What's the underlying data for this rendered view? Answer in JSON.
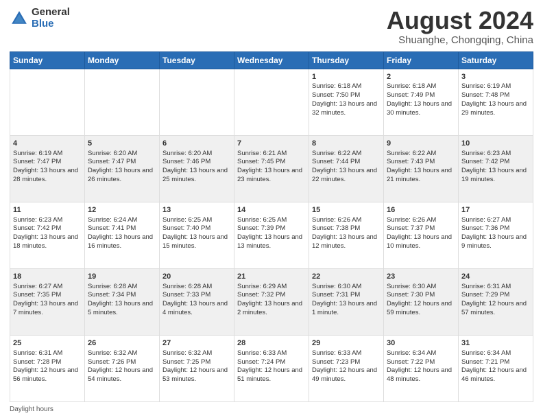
{
  "logo": {
    "general": "General",
    "blue": "Blue"
  },
  "header": {
    "month": "August 2024",
    "location": "Shuanghe, Chongqing, China"
  },
  "days": [
    "Sunday",
    "Monday",
    "Tuesday",
    "Wednesday",
    "Thursday",
    "Friday",
    "Saturday"
  ],
  "weeks": [
    [
      {
        "num": "",
        "data": ""
      },
      {
        "num": "",
        "data": ""
      },
      {
        "num": "",
        "data": ""
      },
      {
        "num": "",
        "data": ""
      },
      {
        "num": "1",
        "data": "Sunrise: 6:18 AM\nSunset: 7:50 PM\nDaylight: 13 hours and 32 minutes."
      },
      {
        "num": "2",
        "data": "Sunrise: 6:18 AM\nSunset: 7:49 PM\nDaylight: 13 hours and 30 minutes."
      },
      {
        "num": "3",
        "data": "Sunrise: 6:19 AM\nSunset: 7:48 PM\nDaylight: 13 hours and 29 minutes."
      }
    ],
    [
      {
        "num": "4",
        "data": "Sunrise: 6:19 AM\nSunset: 7:47 PM\nDaylight: 13 hours and 28 minutes."
      },
      {
        "num": "5",
        "data": "Sunrise: 6:20 AM\nSunset: 7:47 PM\nDaylight: 13 hours and 26 minutes."
      },
      {
        "num": "6",
        "data": "Sunrise: 6:20 AM\nSunset: 7:46 PM\nDaylight: 13 hours and 25 minutes."
      },
      {
        "num": "7",
        "data": "Sunrise: 6:21 AM\nSunset: 7:45 PM\nDaylight: 13 hours and 23 minutes."
      },
      {
        "num": "8",
        "data": "Sunrise: 6:22 AM\nSunset: 7:44 PM\nDaylight: 13 hours and 22 minutes."
      },
      {
        "num": "9",
        "data": "Sunrise: 6:22 AM\nSunset: 7:43 PM\nDaylight: 13 hours and 21 minutes."
      },
      {
        "num": "10",
        "data": "Sunrise: 6:23 AM\nSunset: 7:42 PM\nDaylight: 13 hours and 19 minutes."
      }
    ],
    [
      {
        "num": "11",
        "data": "Sunrise: 6:23 AM\nSunset: 7:42 PM\nDaylight: 13 hours and 18 minutes."
      },
      {
        "num": "12",
        "data": "Sunrise: 6:24 AM\nSunset: 7:41 PM\nDaylight: 13 hours and 16 minutes."
      },
      {
        "num": "13",
        "data": "Sunrise: 6:25 AM\nSunset: 7:40 PM\nDaylight: 13 hours and 15 minutes."
      },
      {
        "num": "14",
        "data": "Sunrise: 6:25 AM\nSunset: 7:39 PM\nDaylight: 13 hours and 13 minutes."
      },
      {
        "num": "15",
        "data": "Sunrise: 6:26 AM\nSunset: 7:38 PM\nDaylight: 13 hours and 12 minutes."
      },
      {
        "num": "16",
        "data": "Sunrise: 6:26 AM\nSunset: 7:37 PM\nDaylight: 13 hours and 10 minutes."
      },
      {
        "num": "17",
        "data": "Sunrise: 6:27 AM\nSunset: 7:36 PM\nDaylight: 13 hours and 9 minutes."
      }
    ],
    [
      {
        "num": "18",
        "data": "Sunrise: 6:27 AM\nSunset: 7:35 PM\nDaylight: 13 hours and 7 minutes."
      },
      {
        "num": "19",
        "data": "Sunrise: 6:28 AM\nSunset: 7:34 PM\nDaylight: 13 hours and 5 minutes."
      },
      {
        "num": "20",
        "data": "Sunrise: 6:28 AM\nSunset: 7:33 PM\nDaylight: 13 hours and 4 minutes."
      },
      {
        "num": "21",
        "data": "Sunrise: 6:29 AM\nSunset: 7:32 PM\nDaylight: 13 hours and 2 minutes."
      },
      {
        "num": "22",
        "data": "Sunrise: 6:30 AM\nSunset: 7:31 PM\nDaylight: 13 hours and 1 minute."
      },
      {
        "num": "23",
        "data": "Sunrise: 6:30 AM\nSunset: 7:30 PM\nDaylight: 12 hours and 59 minutes."
      },
      {
        "num": "24",
        "data": "Sunrise: 6:31 AM\nSunset: 7:29 PM\nDaylight: 12 hours and 57 minutes."
      }
    ],
    [
      {
        "num": "25",
        "data": "Sunrise: 6:31 AM\nSunset: 7:28 PM\nDaylight: 12 hours and 56 minutes."
      },
      {
        "num": "26",
        "data": "Sunrise: 6:32 AM\nSunset: 7:26 PM\nDaylight: 12 hours and 54 minutes."
      },
      {
        "num": "27",
        "data": "Sunrise: 6:32 AM\nSunset: 7:25 PM\nDaylight: 12 hours and 53 minutes."
      },
      {
        "num": "28",
        "data": "Sunrise: 6:33 AM\nSunset: 7:24 PM\nDaylight: 12 hours and 51 minutes."
      },
      {
        "num": "29",
        "data": "Sunrise: 6:33 AM\nSunset: 7:23 PM\nDaylight: 12 hours and 49 minutes."
      },
      {
        "num": "30",
        "data": "Sunrise: 6:34 AM\nSunset: 7:22 PM\nDaylight: 12 hours and 48 minutes."
      },
      {
        "num": "31",
        "data": "Sunrise: 6:34 AM\nSunset: 7:21 PM\nDaylight: 12 hours and 46 minutes."
      }
    ]
  ],
  "footer": {
    "label": "Daylight hours"
  }
}
